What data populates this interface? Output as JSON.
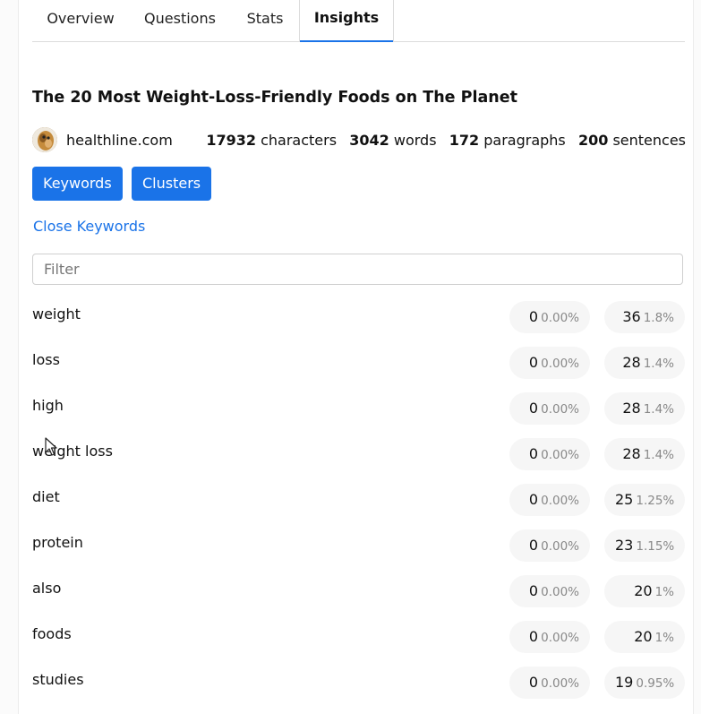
{
  "tabs": [
    {
      "label": "Overview"
    },
    {
      "label": "Questions"
    },
    {
      "label": "Stats"
    },
    {
      "label": "Insights"
    }
  ],
  "article": {
    "title": "The 20 Most Weight-Loss-Friendly Foods on The Planet",
    "domain": "healthline.com",
    "stats": {
      "characters_value": "17932",
      "characters_label": "characters",
      "words_value": "3042",
      "words_label": "words",
      "paragraphs_value": "172",
      "paragraphs_label": "paragraphs",
      "sentences_value": "200",
      "sentences_label": "sentences"
    }
  },
  "buttons": {
    "keywords": "Keywords",
    "clusters": "Clusters"
  },
  "close_keywords": "Close Keywords",
  "filter": {
    "placeholder": "Filter",
    "value": ""
  },
  "keywords": [
    {
      "word": "weight",
      "count1": "0",
      "pct1": "0.00%",
      "count2": "36",
      "pct2": "1.8%"
    },
    {
      "word": "loss",
      "count1": "0",
      "pct1": "0.00%",
      "count2": "28",
      "pct2": "1.4%"
    },
    {
      "word": "high",
      "count1": "0",
      "pct1": "0.00%",
      "count2": "28",
      "pct2": "1.4%"
    },
    {
      "word": "weight loss",
      "count1": "0",
      "pct1": "0.00%",
      "count2": "28",
      "pct2": "1.4%"
    },
    {
      "word": "diet",
      "count1": "0",
      "pct1": "0.00%",
      "count2": "25",
      "pct2": "1.25%"
    },
    {
      "word": "protein",
      "count1": "0",
      "pct1": "0.00%",
      "count2": "23",
      "pct2": "1.15%"
    },
    {
      "word": "also",
      "count1": "0",
      "pct1": "0.00%",
      "count2": "20",
      "pct2": "1%"
    },
    {
      "word": "foods",
      "count1": "0",
      "pct1": "0.00%",
      "count2": "20",
      "pct2": "1%"
    },
    {
      "word": "studies",
      "count1": "0",
      "pct1": "0.00%",
      "count2": "19",
      "pct2": "0.95%"
    }
  ],
  "colors": {
    "accent": "#1a73e8",
    "pill_bg": "#f6f6f6",
    "muted_text": "#888888"
  },
  "icons": {
    "avatar": "site-favicon-icon",
    "cursor": "mouse-pointer-icon"
  }
}
